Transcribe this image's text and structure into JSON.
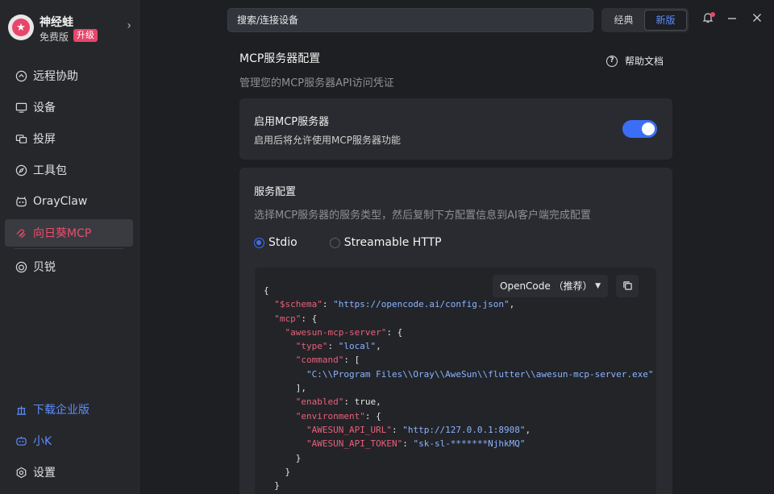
{
  "profile": {
    "name": "神经蛙",
    "plan": "免费版",
    "upgrade": "升级"
  },
  "sidebar": {
    "items": [
      {
        "label": "远程协助",
        "icon": "remote-assist-icon"
      },
      {
        "label": "设备",
        "icon": "monitor-icon"
      },
      {
        "label": "投屏",
        "icon": "cast-screen-icon"
      },
      {
        "label": "工具包",
        "icon": "compass-icon"
      },
      {
        "label": "OrayClaw",
        "icon": "claw-icon"
      },
      {
        "label": "向日葵MCP",
        "icon": "mcp-icon"
      },
      {
        "label": "贝锐",
        "icon": "oray-icon"
      }
    ],
    "bottom": [
      {
        "label": "下载企业版",
        "icon": "enterprise-icon"
      },
      {
        "label": "小K",
        "icon": "robot-icon"
      },
      {
        "label": "设置",
        "icon": "settings-icon"
      }
    ]
  },
  "search": {
    "placeholder": "搜索/连接设备"
  },
  "view_switch": {
    "classic": "经典",
    "new": "新版"
  },
  "page": {
    "title": "MCP服务器配置",
    "subtitle": "管理您的MCP服务器API访问凭证",
    "help": "帮助文档"
  },
  "enable_card": {
    "title": "启用MCP服务器",
    "desc": "启用后将允许使用MCP服务器功能",
    "enabled": true
  },
  "service_card": {
    "title": "服务配置",
    "desc": "选择MCP服务器的服务类型，然后复制下方配置信息到AI客户端完成配置",
    "options": [
      "Stdio",
      "Streamable HTTP"
    ],
    "selected": "Stdio",
    "client_select": "OpenCode （推荐）"
  },
  "code": {
    "open_brace": "{",
    "schema_key": "\"$schema\"",
    "schema_val": "\"https://opencode.ai/config.json\"",
    "mcp_key": "\"mcp\"",
    "server_key": "\"awesun-mcp-server\"",
    "type_key": "\"type\"",
    "type_val": "\"local\"",
    "command_key": "\"command\"",
    "command_val": "\"C:\\\\Program Files\\\\Oray\\\\AweSun\\\\flutter\\\\awesun-mcp-server.exe\"",
    "enabled_key": "\"enabled\"",
    "enabled_val": "true",
    "env_key": "\"environment\"",
    "api_url_key": "\"AWESUN_API_URL\"",
    "api_url_val": "\"http://127.0.0.1:8908\"",
    "api_token_key": "\"AWESUN_API_TOKEN\"",
    "api_token_val": "\"sk-sl-*******NjhkMQ\""
  },
  "colors": {
    "accent_blue": "#3b6ef5",
    "accent_pink": "#e8466a"
  }
}
